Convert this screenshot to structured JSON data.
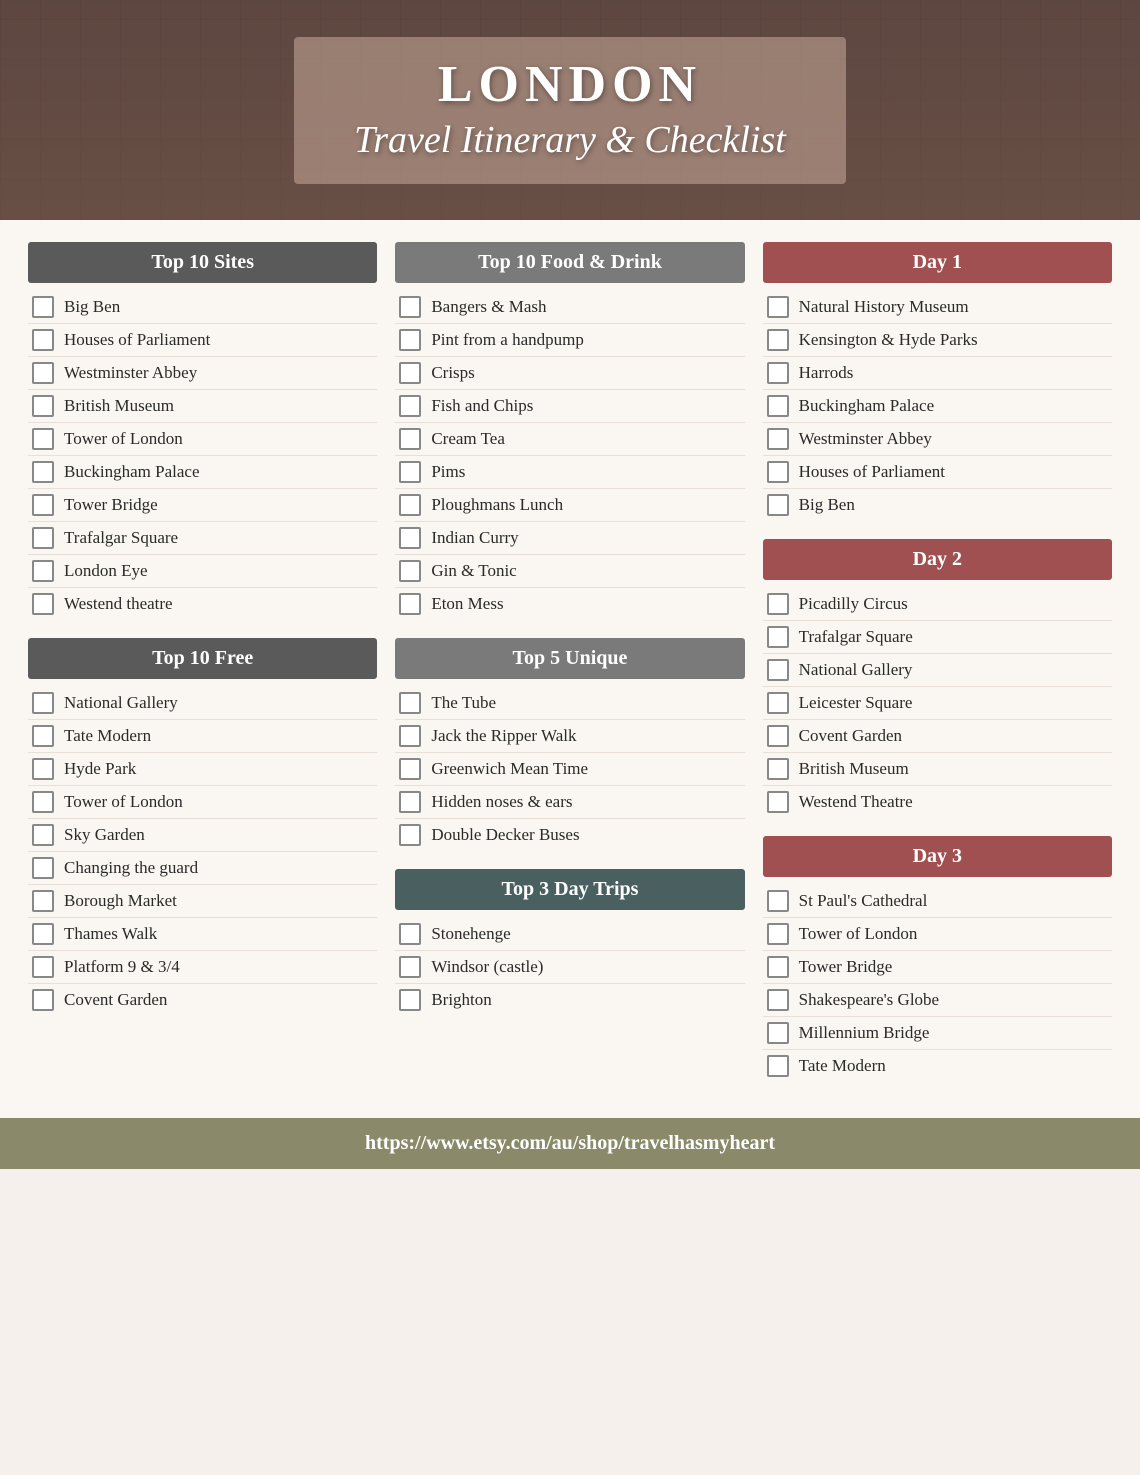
{
  "header": {
    "title": "LONDON",
    "subtitle": "Travel Itinerary & Checklist"
  },
  "col1": {
    "sections": [
      {
        "id": "top10sites",
        "label": "Top 10 Sites",
        "headerClass": "dark-gray",
        "items": [
          "Big Ben",
          "Houses of Parliament",
          "Westminster Abbey",
          "British Museum",
          "Tower of London",
          "Buckingham Palace",
          "Tower Bridge",
          "Trafalgar Square",
          "London Eye",
          "Westend theatre"
        ]
      },
      {
        "id": "top10free",
        "label": "Top 10 Free",
        "headerClass": "dark-gray",
        "items": [
          "National Gallery",
          "Tate Modern",
          "Hyde Park",
          "Tower of London",
          "Sky Garden",
          "Changing the guard",
          "Borough Market",
          "Thames Walk",
          "Platform 9 & 3/4",
          "Covent Garden"
        ]
      }
    ]
  },
  "col2": {
    "sections": [
      {
        "id": "top10food",
        "label": "Top 10 Food & Drink",
        "headerClass": "medium-gray",
        "items": [
          "Bangers & Mash",
          "Pint from a handpump",
          "Crisps",
          "Fish and Chips",
          "Cream Tea",
          "Pims",
          "Ploughmans Lunch",
          "Indian Curry",
          "Gin & Tonic",
          "Eton Mess"
        ]
      },
      {
        "id": "top5unique",
        "label": "Top 5 Unique",
        "headerClass": "medium-gray",
        "items": [
          "The Tube",
          "Jack the Ripper Walk",
          "Greenwich Mean Time",
          "Hidden noses & ears",
          "Double Decker Buses"
        ]
      },
      {
        "id": "top3daytrips",
        "label": "Top 3 Day Trips",
        "headerClass": "dark-teal",
        "items": [
          "Stonehenge",
          "Windsor (castle)",
          "Brighton"
        ]
      }
    ]
  },
  "col3": {
    "sections": [
      {
        "id": "day1",
        "label": "Day 1",
        "headerClass": "day-red",
        "items": [
          "Natural History Museum",
          "Kensington & Hyde Parks",
          "Harrods",
          "Buckingham Palace",
          "Westminster Abbey",
          "Houses of Parliament",
          "Big Ben"
        ]
      },
      {
        "id": "day2",
        "label": "Day 2",
        "headerClass": "day-red",
        "items": [
          "Picadilly Circus",
          "Trafalgar Square",
          "National Gallery",
          "Leicester Square",
          "Covent Garden",
          "British Museum",
          "Westend Theatre"
        ]
      },
      {
        "id": "day3",
        "label": "Day 3",
        "headerClass": "day-red",
        "items": [
          "St Paul's Cathedral",
          "Tower of London",
          "Tower Bridge",
          "Shakespeare's Globe",
          "Millennium Bridge",
          "Tate Modern"
        ]
      }
    ]
  },
  "footer": {
    "url": "https://www.etsy.com/au/shop/travelhasmyheart"
  }
}
